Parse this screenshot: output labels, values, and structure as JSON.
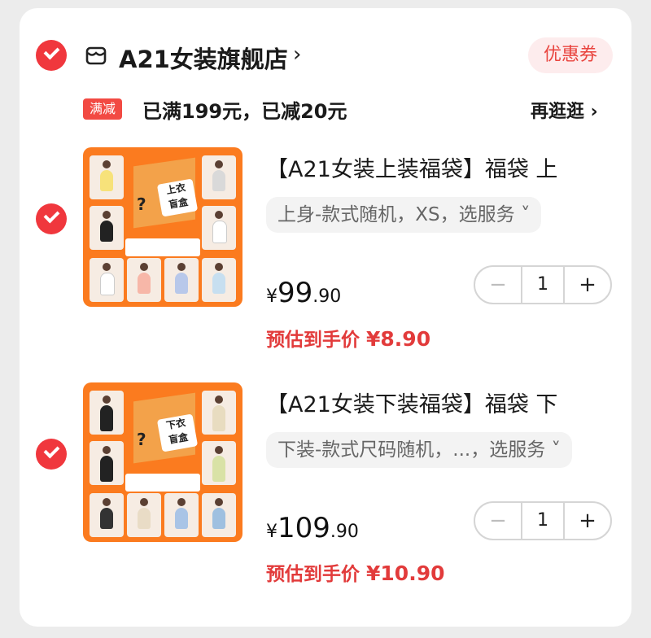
{
  "shop": {
    "name": "A21女装旗舰店",
    "chevron": "›",
    "coupon_label": "优惠券",
    "icon": "store-icon"
  },
  "promo": {
    "tag": "满减",
    "text": "已满199元，已减20元",
    "more_label": "再逛逛 ›"
  },
  "items": [
    {
      "title": "【A21女装上装福袋】福袋 上",
      "sku": "上身-款式随机，XS，选服务 ˅",
      "price_currency": "¥",
      "price_int": "99",
      "price_dec": ".90",
      "est_label": "预估到手价",
      "est_price": "¥8.90",
      "qty": "1",
      "minus": "−",
      "plus": "+",
      "box_label": "上衣\n盲盒",
      "box_mark": "?"
    },
    {
      "title": "【A21女装下装福袋】福袋 下",
      "sku": "下装-款式尺码随机，...，选服务 ˅",
      "price_currency": "¥",
      "price_int": "109",
      "price_dec": ".90",
      "est_label": "预估到手价",
      "est_price": "¥10.90",
      "qty": "1",
      "minus": "−",
      "plus": "+",
      "box_label": "下衣\n盲盒",
      "box_mark": "?"
    }
  ],
  "colors": {
    "accent": "#f0373d",
    "thumb_bg": "#fb7b1f",
    "est_price": "#e23b3b"
  }
}
